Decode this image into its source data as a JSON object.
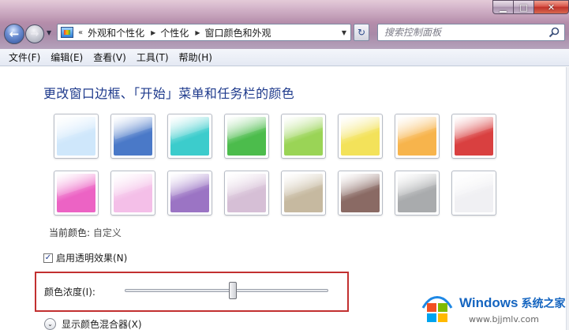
{
  "window": {
    "minimize_glyph": "▁",
    "maximize_glyph": "□",
    "close_glyph": "✕"
  },
  "nav": {
    "back_glyph": "←",
    "forward_glyph": "→",
    "dropdown_glyph": "▼",
    "refresh_glyph": "↻"
  },
  "addressbar": {
    "lead": "«",
    "breadcrumbs": [
      "外观和个性化",
      "个性化",
      "窗口颜色和外观"
    ],
    "separator": "▶",
    "dropdown_glyph": "▼"
  },
  "search": {
    "placeholder": "搜索控制面板"
  },
  "menu": {
    "items": [
      "文件(F)",
      "编辑(E)",
      "查看(V)",
      "工具(T)",
      "帮助(H)"
    ]
  },
  "main": {
    "title": "更改窗口边框、「开始」菜单和任务栏的颜色",
    "swatches": [
      {
        "name": "sky",
        "color": "#cfe7fb"
      },
      {
        "name": "twilight",
        "color": "#4a79c8"
      },
      {
        "name": "sea",
        "color": "#3ccccc"
      },
      {
        "name": "leaf",
        "color": "#4cbc4c"
      },
      {
        "name": "lime",
        "color": "#9ad456"
      },
      {
        "name": "lemon",
        "color": "#f3e25a"
      },
      {
        "name": "pumpkin",
        "color": "#f7b44c"
      },
      {
        "name": "ruby",
        "color": "#d94040"
      },
      {
        "name": "fuchsia",
        "color": "#ec63c4"
      },
      {
        "name": "blush",
        "color": "#f4bfe8"
      },
      {
        "name": "violet",
        "color": "#9b74c4"
      },
      {
        "name": "lavender",
        "color": "#d6bfd6"
      },
      {
        "name": "taupe",
        "color": "#c6b9a0"
      },
      {
        "name": "chocolate",
        "color": "#8a6a64"
      },
      {
        "name": "slate",
        "color": "#a9abad"
      },
      {
        "name": "frost",
        "color": "#f0f0f3"
      }
    ],
    "current_color_label": "当前颜色:",
    "current_color_value": "自定义",
    "transparency": {
      "label": "启用透明效果(N)",
      "checked": true,
      "check_glyph": "✓"
    },
    "intensity": {
      "label": "颜色浓度(I):",
      "value_fraction": 0.53
    },
    "mixer": {
      "label": "显示颜色混合器(X)",
      "expand_glyph": "⌄"
    }
  },
  "watermark": {
    "brand": "Windows",
    "site": "系统之家",
    "url": "www.bjjmlv.com"
  }
}
